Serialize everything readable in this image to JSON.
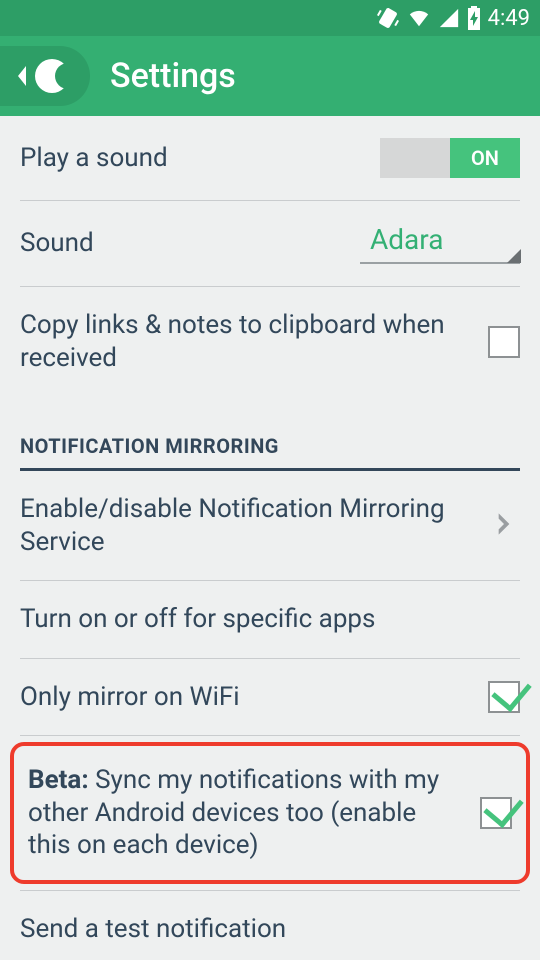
{
  "status": {
    "time": "4:49"
  },
  "header": {
    "title": "Settings"
  },
  "settings": {
    "play_sound": {
      "label": "Play a sound",
      "toggle_on_text": "ON",
      "state": "on"
    },
    "sound": {
      "label": "Sound",
      "value": "Adara"
    },
    "copy_links": {
      "label": "Copy links & notes to clipboard when received",
      "checked": false
    }
  },
  "section_mirroring": {
    "header": "NOTIFICATION MIRRORING",
    "enable_service": {
      "label": "Enable/disable Notification Mirroring Service"
    },
    "specific_apps": {
      "label": "Turn on or off for specific apps"
    },
    "wifi_only": {
      "label": "Only mirror on WiFi",
      "checked": true
    },
    "beta_sync": {
      "prefix": "Beta:",
      "label": " Sync my notifications with my other Android devices too (enable this on each device)",
      "checked": true
    },
    "test_notification": {
      "label": "Send a test notification"
    }
  }
}
